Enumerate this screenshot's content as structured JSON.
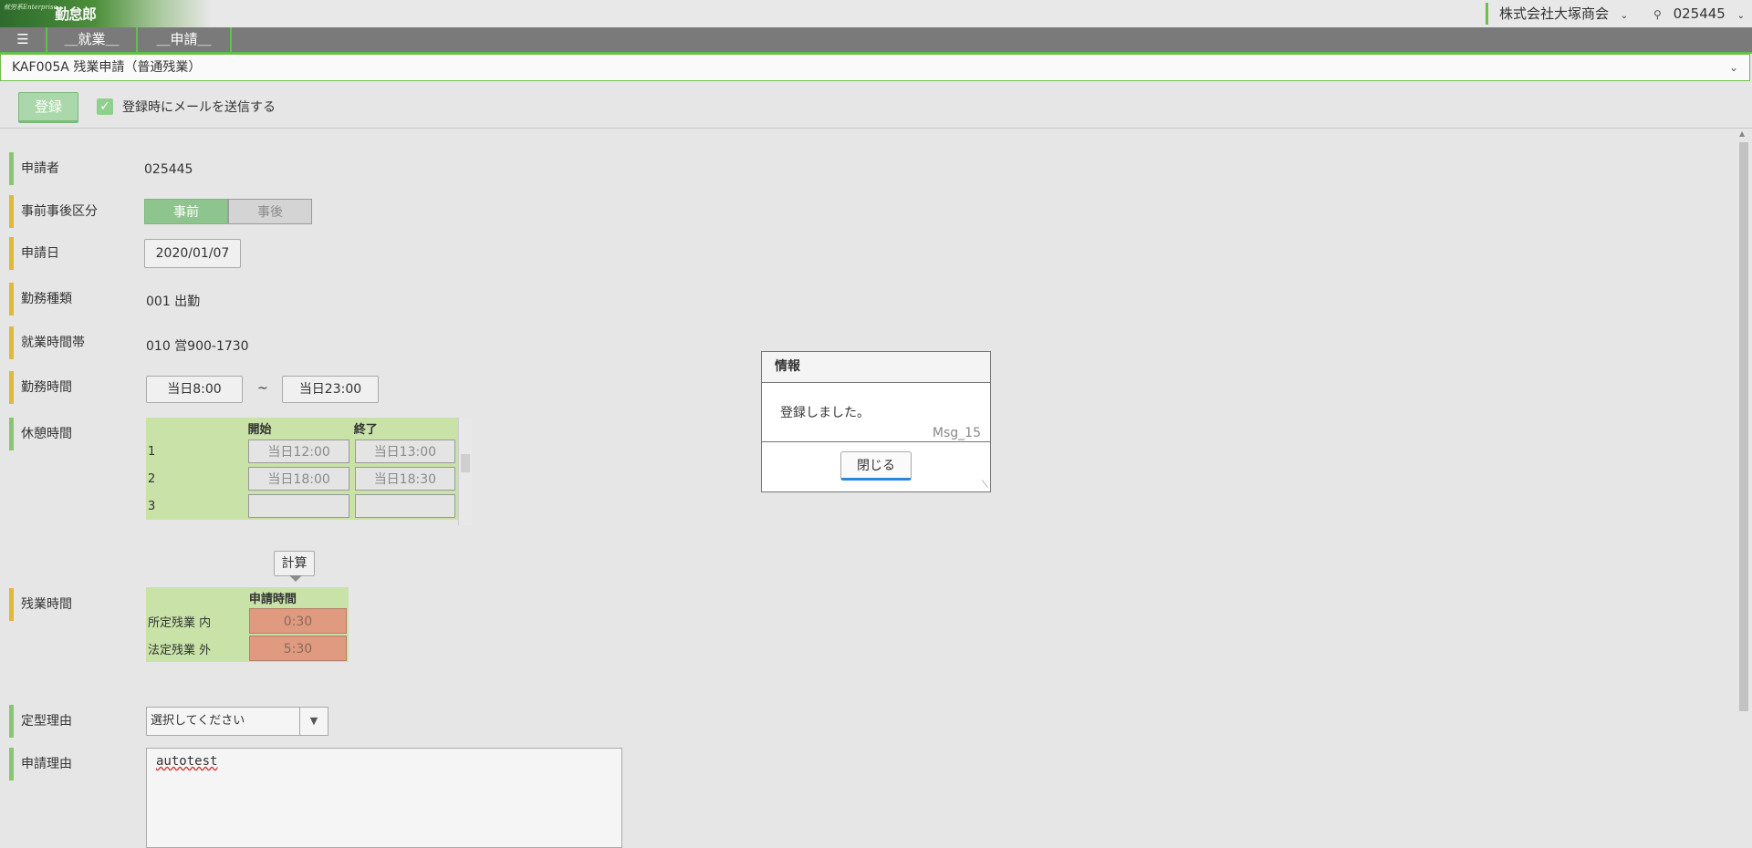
{
  "header": {
    "logo_small": "就労系Enterprise",
    "logo_big": "勤怠郎",
    "company": "株式会社大塚商会",
    "user_id": "025445"
  },
  "nav": {
    "menu_icon": "☰",
    "items": [
      "＿就業＿",
      "＿申請＿"
    ]
  },
  "title": "KAF005A 残業申請（普通残業）",
  "toolbar": {
    "register_label": "登録",
    "mail_checkbox_label": "登録時にメールを送信する",
    "mail_checked": true
  },
  "form": {
    "applicant_label": "申請者",
    "applicant_value": "025445",
    "prepost_label": "事前事後区分",
    "prepost_options": [
      "事前",
      "事後"
    ],
    "prepost_selected": "事前",
    "date_label": "申請日",
    "date_value": "2020/01/07",
    "worktype_label": "勤務種類",
    "worktype_value": "001 出勤",
    "worktime_label": "就業時間帯",
    "worktime_value": "010 営900-1730",
    "workhours_label": "勤務時間",
    "work_start": "当日8:00",
    "tilde": "~",
    "work_end": "当日23:00",
    "break_label": "休憩時間",
    "break_headers": [
      "開始",
      "終了"
    ],
    "break_rows": [
      {
        "no": "1",
        "start": "当日12:00",
        "end": "当日13:00"
      },
      {
        "no": "2",
        "start": "当日18:00",
        "end": "当日18:30"
      },
      {
        "no": "3",
        "start": "",
        "end": ""
      }
    ],
    "calc_label": "計算",
    "overtime_label": "残業時間",
    "overtime_header": "申請時間",
    "overtime_rows": [
      {
        "name": "所定残業 内",
        "value": "0:30"
      },
      {
        "name": "法定残業 外",
        "value": "5:30"
      }
    ],
    "fixed_reason_label": "定型理由",
    "fixed_reason_placeholder": "選択してください",
    "reason_label": "申請理由",
    "reason_value": "autotest"
  },
  "dialog": {
    "title": "情報",
    "message": "登録しました。",
    "code": "Msg_15",
    "close_label": "閉じる"
  },
  "colors": {
    "accent_green": "#6fbf4a",
    "nav_gray": "#7a7a7a",
    "required_yellow": "#e0b83a",
    "optional_green": "#8cc472",
    "overtime_cell": "#e09a80"
  }
}
